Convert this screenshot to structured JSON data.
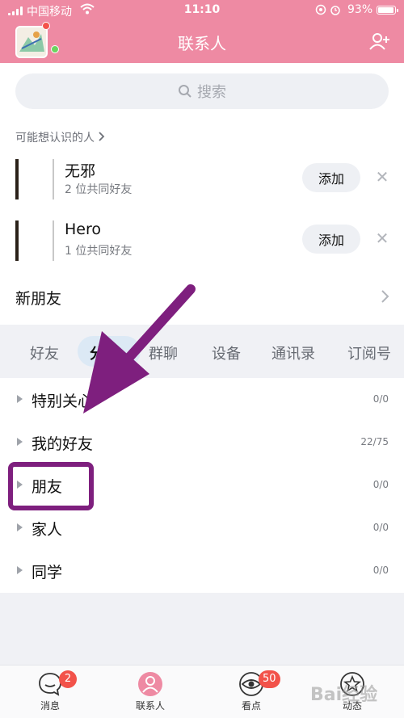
{
  "status_bar": {
    "carrier": "中国移动",
    "time": "11:10",
    "battery": "93%",
    "battery_level": 0.93
  },
  "header": {
    "title": "联系人",
    "add_contact_icon": "add-person-icon"
  },
  "search": {
    "placeholder": "搜索",
    "icon": "search-icon"
  },
  "people_you_may_know": {
    "title": "可能想认识的人",
    "items": [
      {
        "name": "无邪",
        "mutual": "2 位共同好友",
        "add_label": "添加"
      },
      {
        "name": "Hero",
        "mutual": "1 位共同好友",
        "add_label": "添加"
      }
    ]
  },
  "new_friends": {
    "label": "新朋友"
  },
  "tabs": [
    "好友",
    "分组",
    "群聊",
    "设备",
    "通讯录",
    "订阅号"
  ],
  "active_tab": "分组",
  "groups": [
    {
      "name": "特别关心",
      "count": "0/0"
    },
    {
      "name": "我的好友",
      "count": "22/75"
    },
    {
      "name": "朋友",
      "count": "0/0"
    },
    {
      "name": "家人",
      "count": "0/0"
    },
    {
      "name": "同学",
      "count": "0/0"
    }
  ],
  "bottom_nav": [
    {
      "label": "消息",
      "icon": "message-icon",
      "badge": "2"
    },
    {
      "label": "联系人",
      "icon": "contacts-icon",
      "badge": ""
    },
    {
      "label": "看点",
      "icon": "eye-icon",
      "badge": "50"
    },
    {
      "label": "动态",
      "icon": "star-icon",
      "badge": ""
    }
  ],
  "colors": {
    "header_pink": "#ee8aa3",
    "annotation_purple": "#7e1f7e",
    "badge_red": "#f2524a",
    "active_tab_bg": "#dce9f5"
  },
  "watermark": "Bai经验"
}
